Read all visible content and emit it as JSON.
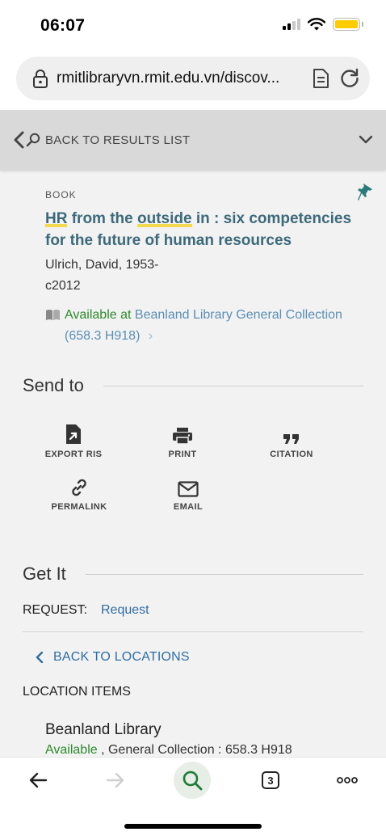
{
  "status_bar": {
    "time": "06:07",
    "battery_color": "#ffcc00"
  },
  "browser": {
    "url": "rmitlibraryvn.rmit.edu.vn/discov..."
  },
  "results_nav": {
    "back_label": "BACK TO RESULTS LIST"
  },
  "record": {
    "type": "BOOK",
    "title_parts": [
      "HR",
      " from the ",
      "outside",
      " in : six competencies for the future of human resources"
    ],
    "author": "Ulrich, David, 1953-",
    "year": "c2012",
    "availability_status": "Available at",
    "availability_location": "Beanland Library  General Collection (658.3 H918)"
  },
  "send_to": {
    "heading": "Send to",
    "actions": [
      {
        "label": "EXPORT RIS",
        "icon": "export-ris-icon"
      },
      {
        "label": "PRINT",
        "icon": "printer-icon"
      },
      {
        "label": "CITATION",
        "icon": "quote-icon"
      },
      {
        "label": "PERMALINK",
        "icon": "link-icon"
      },
      {
        "label": "EMAIL",
        "icon": "envelope-icon"
      }
    ]
  },
  "get_it": {
    "heading": "Get It",
    "request_label": "REQUEST:",
    "request_link": "Request",
    "back_to_locations": "BACK TO LOCATIONS",
    "location_items_label": "LOCATION ITEMS",
    "library_name": "Beanland Library",
    "item_status": "Available",
    "item_detail": " , General Collection : 658.3 H918"
  },
  "bottom_toolbar": {
    "tab_count": "3"
  },
  "colors": {
    "link": "#2e6da4",
    "available": "#2b8a2b",
    "title": "#3d6a7a",
    "highlight": "#f2d94e",
    "pin": "#2a7a7a"
  }
}
